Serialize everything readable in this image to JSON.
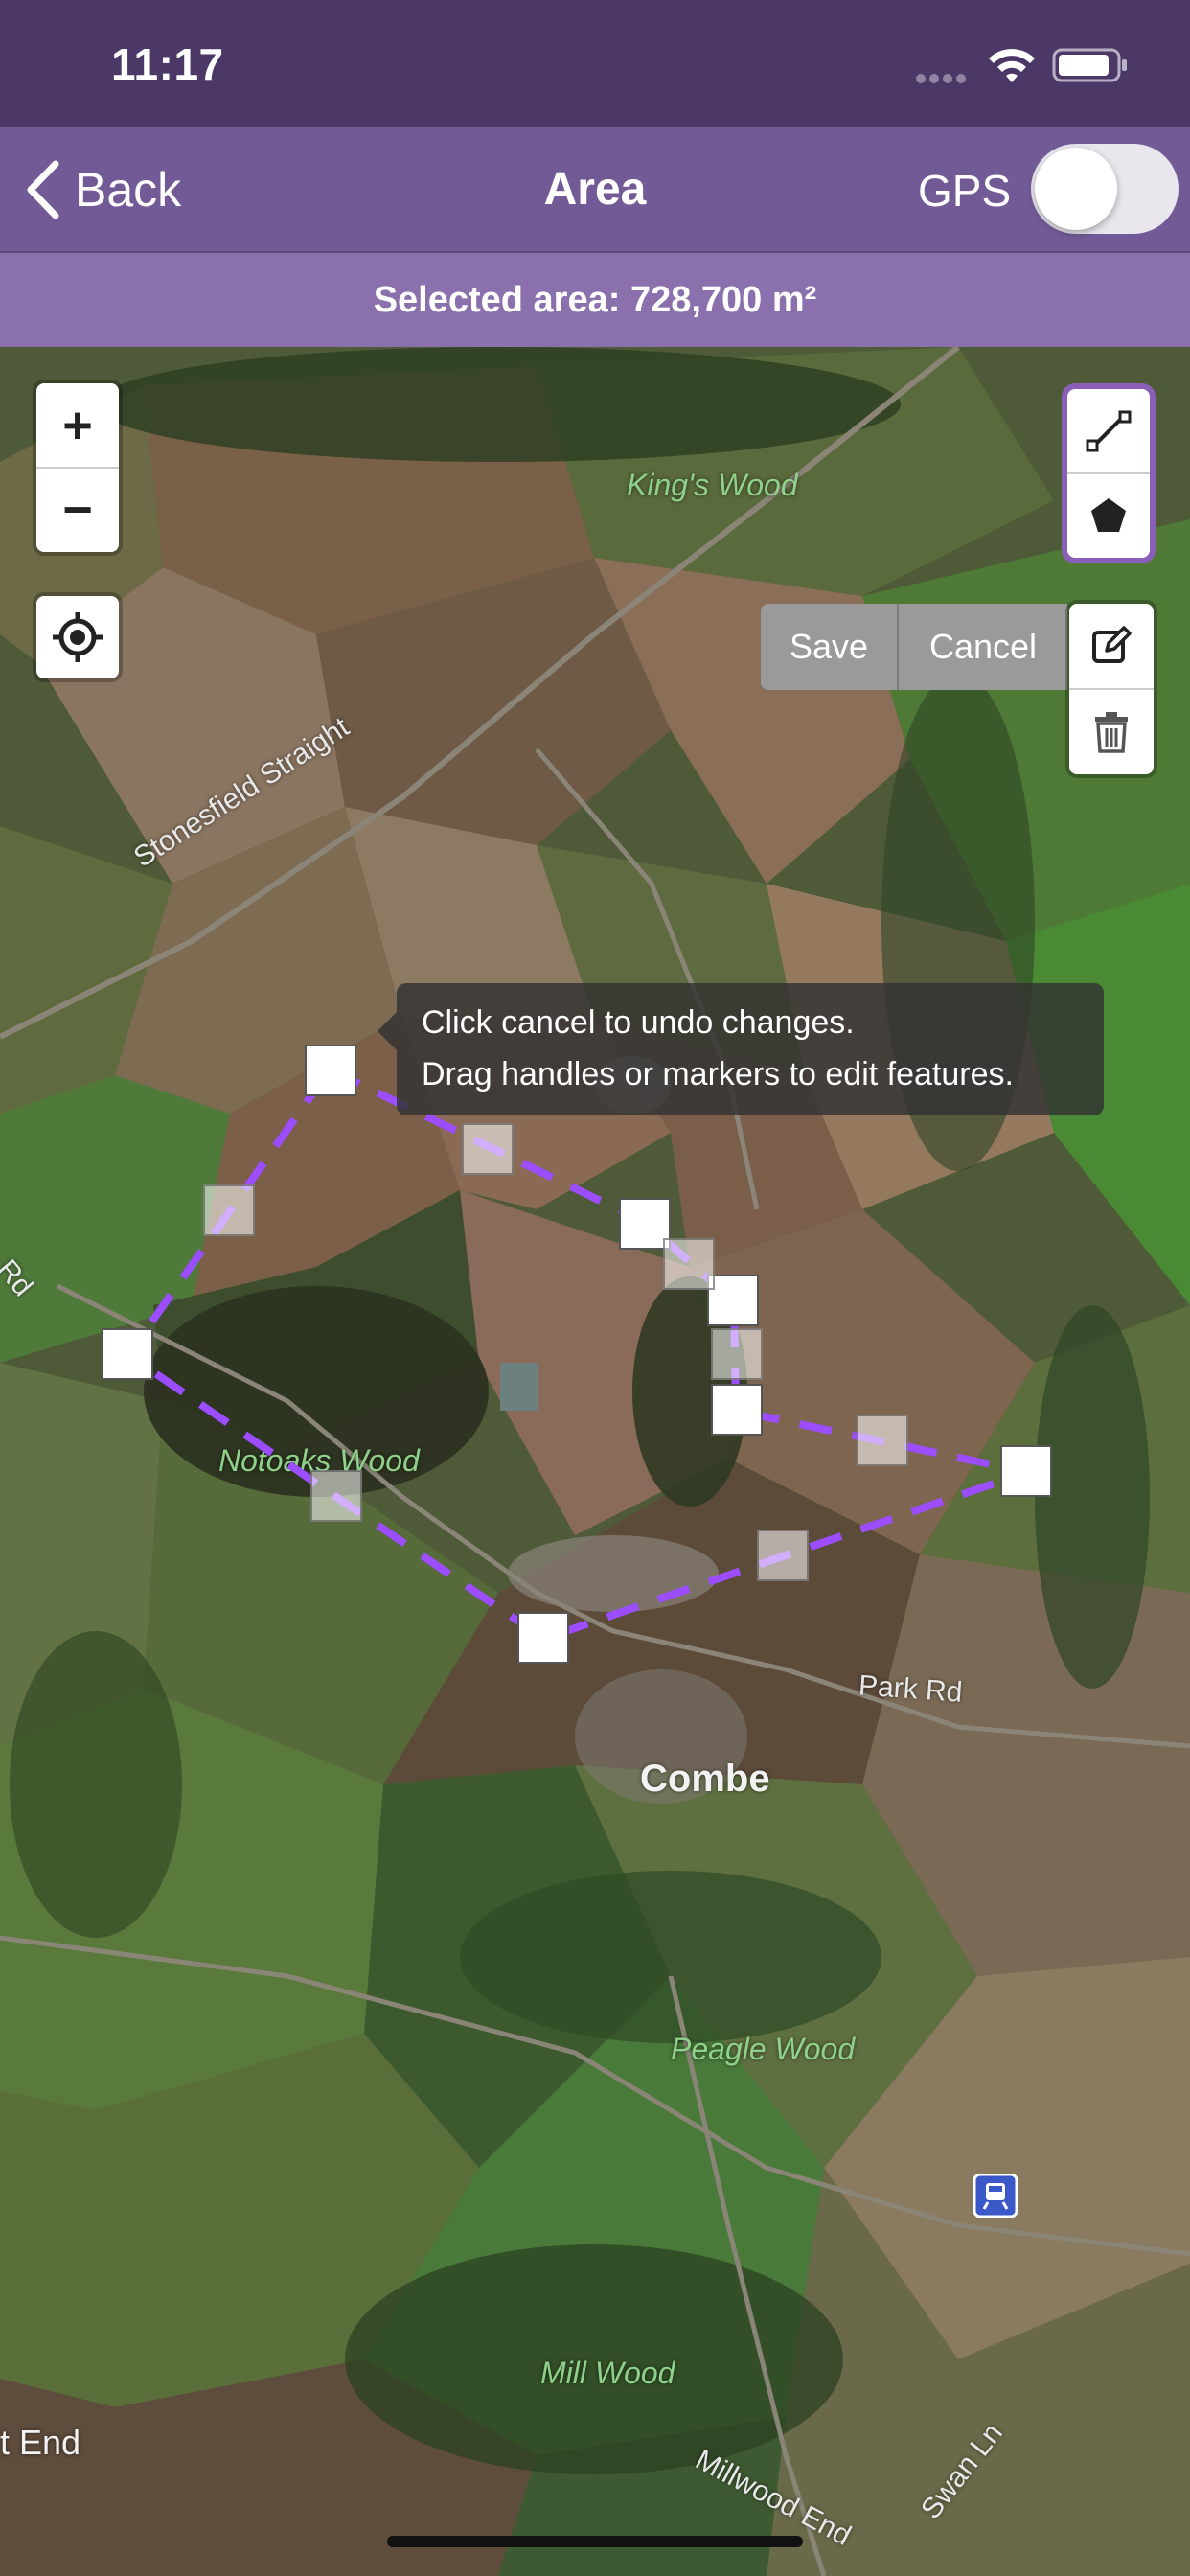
{
  "status_bar": {
    "time": "11:17",
    "icons": [
      "signal-icon",
      "wifi-icon",
      "battery-icon"
    ]
  },
  "nav": {
    "back_label": "Back",
    "title": "Area",
    "gps_label": "GPS",
    "gps_enabled": false
  },
  "area_bar": {
    "text": "Selected area: 728,700 m²"
  },
  "map": {
    "zoom_controls": {
      "zoom_in": "+",
      "zoom_out": "−",
      "locate_icon": "locate-icon"
    },
    "draw_toolbar": {
      "line_icon": "draw-line-icon",
      "polygon_icon": "draw-polygon-icon"
    },
    "edit_toolbar": {
      "edit_icon": "edit-icon",
      "delete_icon": "delete-icon"
    },
    "actions": {
      "save": "Save",
      "cancel": "Cancel"
    },
    "tooltip": {
      "line1": "Click cancel to undo changes.",
      "line2": "Drag handles or markers to edit features."
    },
    "labels": {
      "kings_wood": "King's Wood",
      "stonesfield_straight": "Stonesfield Straight",
      "rd_left": "Rd",
      "notoaks_wood": "Notoaks Wood",
      "park_rd": "Park Rd",
      "combe": "Combe",
      "peagle_wood": "Peagle Wood",
      "mill_wood": "Mill Wood",
      "end_left": "t End",
      "millwood_end": "Millwood End",
      "swan_ln": "Swan Ln"
    },
    "polygon_color": "#9b4dff",
    "station_icon": "train-station-icon"
  },
  "colors": {
    "status_bar": "#4b3866",
    "nav_bar": "#725a96",
    "area_bar": "#8a70ad",
    "draw_toolbar_border": "#8a5fb8"
  }
}
